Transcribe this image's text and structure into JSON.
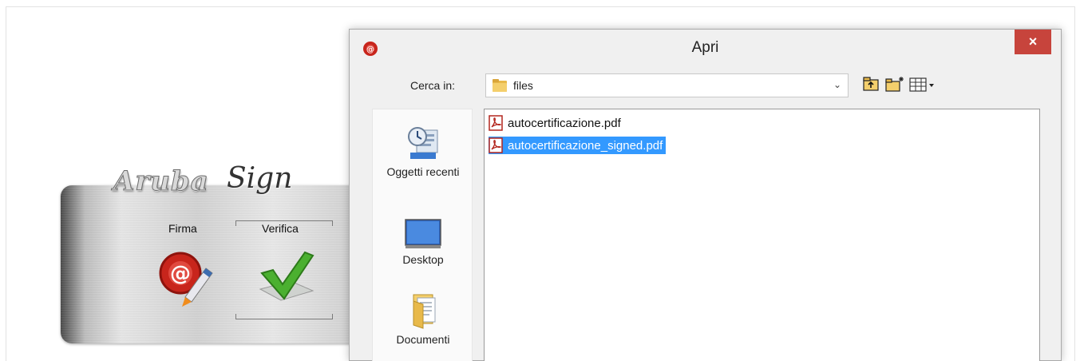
{
  "app": {
    "logo_text": "Aruba",
    "logo_script": "Sign",
    "firma_label": "Firma",
    "verifica_label": "Verifica"
  },
  "dialog": {
    "title": "Apri",
    "close_label": "×",
    "look_in_label": "Cerca in:",
    "look_in_value": "files",
    "places": [
      {
        "label": "Oggetti recenti",
        "icon": "recent-items-icon"
      },
      {
        "label": "Desktop",
        "icon": "desktop-icon"
      },
      {
        "label": "Documenti",
        "icon": "documents-icon"
      }
    ],
    "files": [
      {
        "name": "autocertificazione.pdf",
        "icon": "pdf-file-icon",
        "selected": false
      },
      {
        "name": "autocertificazione_signed.pdf",
        "icon": "pdf-file-icon",
        "selected": true
      }
    ]
  },
  "colors": {
    "selection": "#3399ff",
    "close_button": "#c7443c",
    "dialog_bg": "#f0f0f0"
  }
}
